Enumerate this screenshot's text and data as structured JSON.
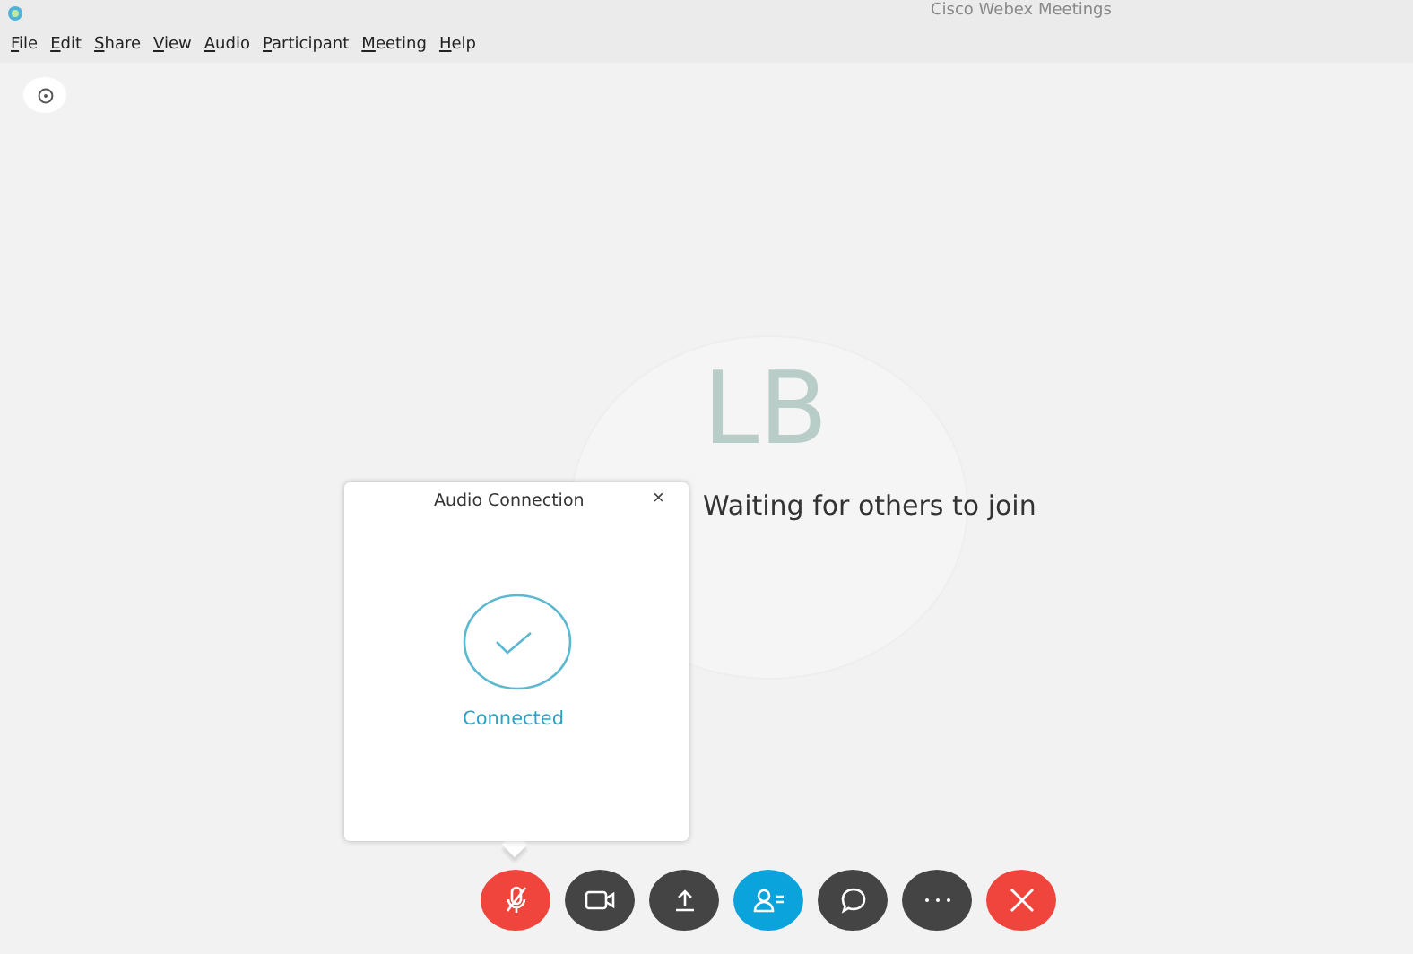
{
  "window": {
    "title": "Cisco Webex Meetings"
  },
  "menu": [
    "File",
    "Edit",
    "Share",
    "View",
    "Audio",
    "Participant",
    "Meeting",
    "Help"
  ],
  "avatar": {
    "initials": "LB"
  },
  "status": "Waiting for others to join",
  "dialog": {
    "title": "Audio Connection",
    "close": "×",
    "state": "Connected"
  },
  "controls": [
    {
      "kind": "mute",
      "color": "#f0453c"
    },
    {
      "kind": "video",
      "color": "#444444"
    },
    {
      "kind": "share",
      "color": "#444444"
    },
    {
      "kind": "participants",
      "color": "#0aa3dc"
    },
    {
      "kind": "chat",
      "color": "#444444"
    },
    {
      "kind": "more",
      "color": "#444444"
    },
    {
      "kind": "leave",
      "color": "#f0453c"
    }
  ]
}
